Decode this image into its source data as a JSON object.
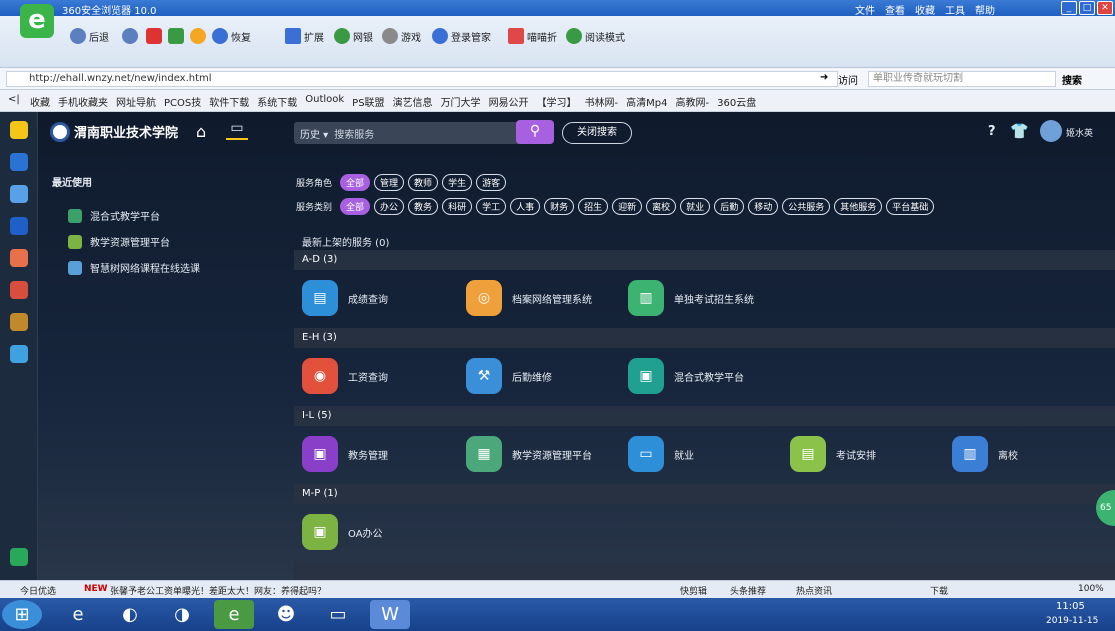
{
  "browser": {
    "title": "360安全浏览器 10.0",
    "menus": [
      "文件",
      "查看",
      "收藏",
      "工具",
      "帮助"
    ],
    "toolbar": {
      "back": "后退",
      "restore": "恢复",
      "ext": "扩展",
      "bank": "网银",
      "game": "游戏",
      "login": "登录管家",
      "pingan": "喵喵折",
      "read": "阅读模式"
    },
    "url": "http://ehall.wnzy.net/new/index.html",
    "visit": "访问",
    "search_placeholder": "单职业传奇就玩切割",
    "search_label": "搜索",
    "favorites": [
      "收藏",
      "手机收藏夹",
      "网址导航",
      "PCOS技",
      "软件下载",
      "系统下载",
      "Outlook",
      "PS联盟",
      "演艺信息",
      "万门大学",
      "网易公开",
      "【学习】",
      "书林网-",
      "高清Mp4",
      "高教网-",
      "360云盘"
    ]
  },
  "portal": {
    "school": "渭南职业技术学院",
    "history": "历史",
    "search_placeholder": "搜索服务",
    "close_search": "关闭搜索",
    "user": "姬水英",
    "recent_title": "最近使用",
    "recent": [
      "混合式教学平台",
      "教学资源管理平台",
      "智慧树网络课程在线选课"
    ],
    "role_label": "服务角色",
    "roles": [
      "全部",
      "管理",
      "教师",
      "学生",
      "游客"
    ],
    "cat_label": "服务类别",
    "cats": [
      "全部",
      "办公",
      "教务",
      "科研",
      "学工",
      "人事",
      "财务",
      "招生",
      "迎新",
      "离校",
      "就业",
      "后勤",
      "移动",
      "公共服务",
      "其他服务",
      "平台基础"
    ],
    "new_title": "最新上架的服务 (0)",
    "sections": [
      {
        "title": "A-D (3)",
        "items": [
          "成绩查询",
          "档案网络管理系统",
          "单独考试招生系统"
        ]
      },
      {
        "title": "E-H (3)",
        "items": [
          "工资查询",
          "后勤维修",
          "混合式教学平台"
        ]
      },
      {
        "title": "I-L (5)",
        "items": [
          "教务管理",
          "教学资源管理平台",
          "就业",
          "考试安排",
          "离校"
        ]
      },
      {
        "title": "M-P (1)",
        "items": [
          "OA办公"
        ]
      }
    ],
    "rail": "65"
  },
  "status": {
    "today": "今日优选",
    "news": "张馨予老公工资单曝光！差距太大！网友：养得起吗？",
    "right": [
      "快剪辑",
      "头条推荐",
      "热点资讯",
      "下载",
      "100%"
    ]
  },
  "taskbar": {
    "time": "11:05",
    "date": "2019-11-15"
  }
}
